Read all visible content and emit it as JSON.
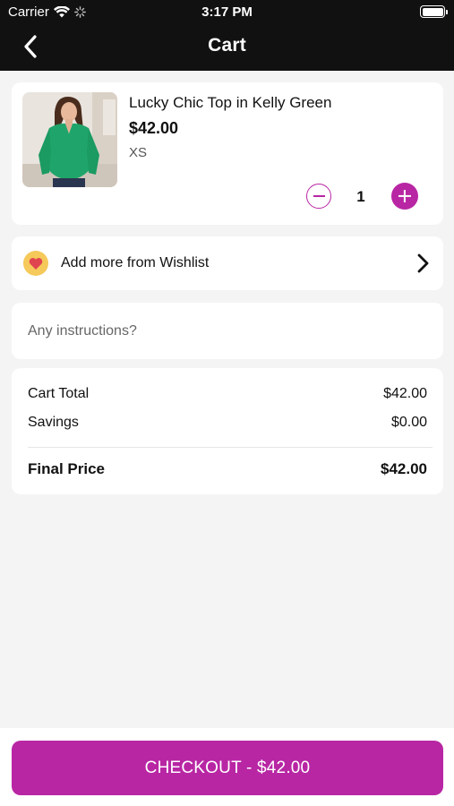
{
  "status_bar": {
    "carrier": "Carrier",
    "time": "3:17 PM"
  },
  "nav": {
    "title": "Cart",
    "back_icon": "chevron-left-icon"
  },
  "cart_item": {
    "name": "Lucky Chic Top in Kelly Green",
    "price": "$42.00",
    "size": "XS",
    "quantity": "1",
    "image": "green-blouse-photo",
    "accent_color": "#b826a4"
  },
  "wishlist": {
    "label": "Add more from Wishlist",
    "icon": "heart-icon"
  },
  "instructions": {
    "placeholder": "Any instructions?",
    "value": ""
  },
  "summary": {
    "cart_total_label": "Cart Total",
    "cart_total_value": "$42.00",
    "savings_label": "Savings",
    "savings_value": "$0.00",
    "final_label": "Final Price",
    "final_value": "$42.00"
  },
  "checkout": {
    "label": "CHECKOUT - $42.00"
  },
  "colors": {
    "nav_background": "#111111",
    "page_background": "#f4f4f4",
    "accent": "#b826a4"
  }
}
